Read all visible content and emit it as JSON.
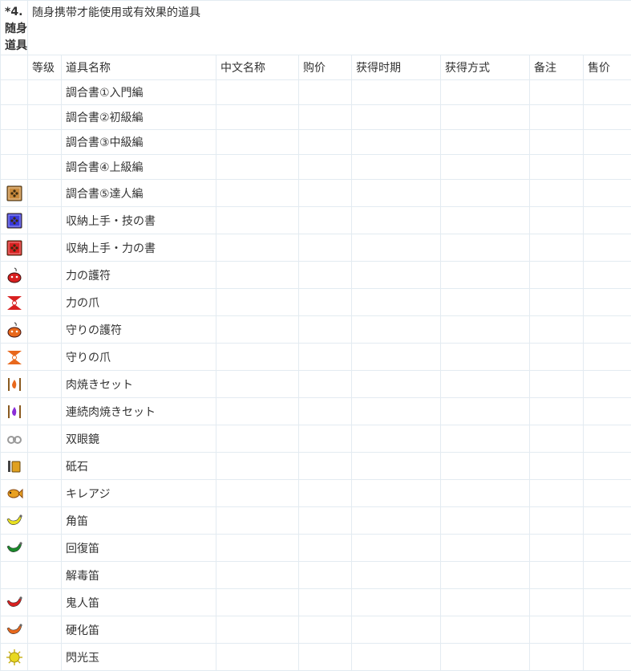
{
  "section": {
    "title": "*4.随身道具",
    "description": "随身携带才能使用或有效果的道具"
  },
  "columns": [
    "等级",
    "道具名称",
    "中文名称",
    "购价",
    "获得时期",
    "获得方式",
    "备注",
    "售价"
  ],
  "items": [
    {
      "name": "調合書①入門編",
      "icon": ""
    },
    {
      "name": "調合書②初級編",
      "icon": ""
    },
    {
      "name": "調合書③中級編",
      "icon": ""
    },
    {
      "name": "調合書④上級編",
      "icon": ""
    },
    {
      "name": "調合書⑤達人編",
      "icon": "book-gold-icon",
      "color": "#c98a3c"
    },
    {
      "name": "収納上手・技の書",
      "icon": "book-blue-icon",
      "color": "#3a3adc"
    },
    {
      "name": "収納上手・力の書",
      "icon": "book-red-icon",
      "color": "#d82020"
    },
    {
      "name": "力の護符",
      "icon": "charm-red-icon",
      "color": "#d82020"
    },
    {
      "name": "力の爪",
      "icon": "claw-red-icon",
      "color": "#d82020"
    },
    {
      "name": "守りの護符",
      "icon": "charm-orange-icon",
      "color": "#e8681c"
    },
    {
      "name": "守りの爪",
      "icon": "claw-orange-icon",
      "color": "#e8681c"
    },
    {
      "name": "肉焼きセット",
      "icon": "meat-roaster-icon",
      "color": "#e8681c"
    },
    {
      "name": "連続肉焼きセット",
      "icon": "meat-roaster-purple-icon",
      "color": "#8a2ed8"
    },
    {
      "name": "双眼鏡",
      "icon": "binoculars-icon",
      "color": "#9a9a9a"
    },
    {
      "name": "砥石",
      "icon": "whetstone-icon",
      "color": "#e0a020"
    },
    {
      "name": "キレアジ",
      "icon": "fish-icon",
      "color": "#e8a020"
    },
    {
      "name": "角笛",
      "icon": "horn-yellow-icon",
      "color": "#e8e020"
    },
    {
      "name": "回復笛",
      "icon": "horn-green-icon",
      "color": "#1a8a2a"
    },
    {
      "name": "解毒笛",
      "icon": ""
    },
    {
      "name": "鬼人笛",
      "icon": "horn-red-icon",
      "color": "#d82020"
    },
    {
      "name": "硬化笛",
      "icon": "horn-orange-icon",
      "color": "#e8681c"
    },
    {
      "name": "閃光玉",
      "icon": "flash-bomb-icon",
      "color": "#e8d820"
    }
  ]
}
